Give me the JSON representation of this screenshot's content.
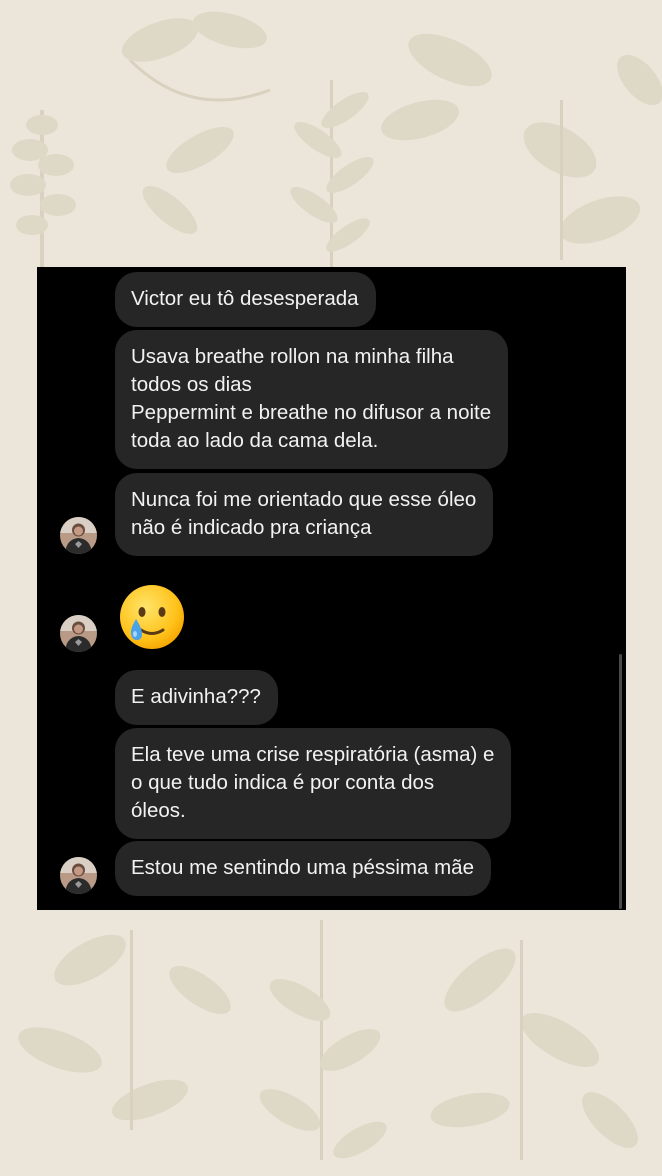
{
  "colors": {
    "page_background": "#ece6da",
    "chat_background": "#000000",
    "bubble_background": "#262626",
    "bubble_text": "#f2f2f2"
  },
  "messages": [
    {
      "lines": [
        "Victor eu tô desesperada"
      ]
    },
    {
      "lines": [
        "Usava breathe rollon na minha filha",
        "todos os dias",
        "Peppermint e breathe no difusor a noite",
        "toda ao lado da cama dela."
      ]
    },
    {
      "lines": [
        "Nunca foi me orientado que esse óleo",
        "não é indicado pra criança"
      ]
    },
    {
      "emoji": "smiling-face-with-tear"
    },
    {
      "lines": [
        "E adivinha???"
      ]
    },
    {
      "lines": [
        "Ela teve uma crise respiratória (asma) e",
        "o que tudo indica é por conta dos",
        "óleos."
      ]
    },
    {
      "lines": [
        "Estou me sentindo uma péssima mãe"
      ]
    }
  ],
  "icons": {
    "avatar": "contact-avatar-icon",
    "emoji": "smiling-face-with-tear-icon",
    "background": "botanical-leaves-illustration"
  }
}
